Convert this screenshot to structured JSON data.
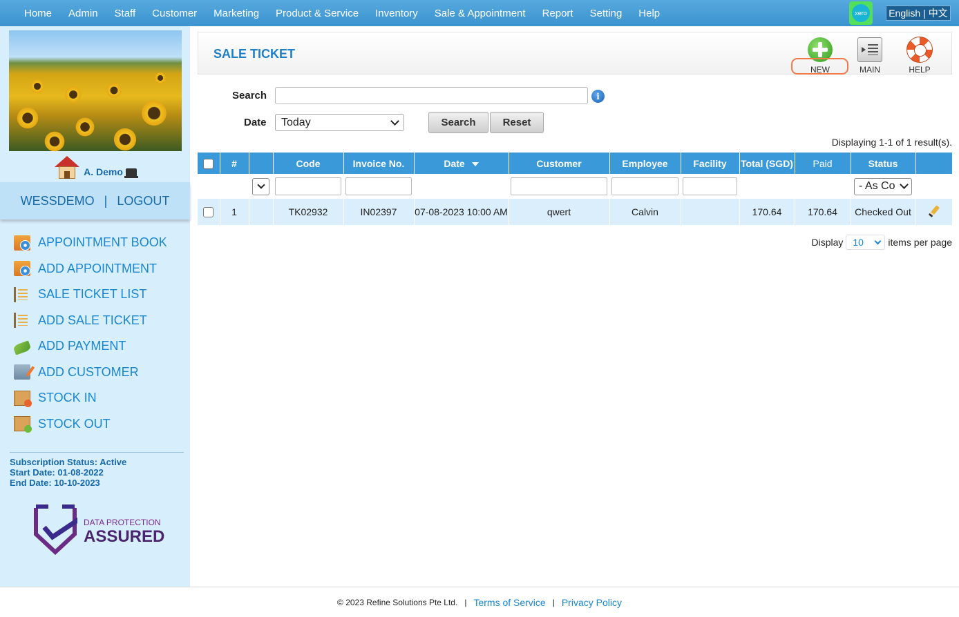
{
  "nav": {
    "items": [
      "Home",
      "Admin",
      "Staff",
      "Customer",
      "Marketing",
      "Product & Service",
      "Inventory",
      "Sale & Appointment",
      "Report",
      "Setting",
      "Help"
    ],
    "xero_label": "xero",
    "lang_english": "English",
    "lang_sep": "|",
    "lang_chinese": "中文"
  },
  "sidebar": {
    "user_name": "A. Demo",
    "company": "WESSDEMO",
    "sep": "|",
    "logout": "LOGOUT",
    "links": [
      {
        "label": "APPOINTMENT BOOK",
        "icon": "calendar-icon"
      },
      {
        "label": "ADD APPOINTMENT",
        "icon": "calendar-add-icon"
      },
      {
        "label": "SALE TICKET LIST",
        "icon": "ticket-list-icon"
      },
      {
        "label": "ADD SALE TICKET",
        "icon": "ticket-add-icon"
      },
      {
        "label": "ADD PAYMENT",
        "icon": "money-icon"
      },
      {
        "label": "ADD CUSTOMER",
        "icon": "customer-card-icon"
      },
      {
        "label": "STOCK IN",
        "icon": "box-in-icon"
      },
      {
        "label": "STOCK OUT",
        "icon": "box-out-icon"
      }
    ],
    "subscription_status": "Subscription Status: Active",
    "start_date": "Start Date: 01-08-2022",
    "end_date": "End Date: 10-10-2023",
    "dpa_line1": "DATA PROTECTION",
    "dpa_line2": "ASSURED"
  },
  "header": {
    "title": "SALE TICKET",
    "new_label": "NEW",
    "main_label": "MAIN",
    "help_label": "HELP"
  },
  "search": {
    "label": "Search",
    "value": "",
    "date_label": "Date",
    "date_value": "Today",
    "search_button": "Search",
    "reset_button": "Reset"
  },
  "results": "Displaying 1-1 of 1 result(s).",
  "table": {
    "columns": [
      "#",
      "Code",
      "Invoice No.",
      "Date",
      "Customer",
      "Employee",
      "Facility",
      "Total (SGD)",
      "Paid",
      "Status"
    ],
    "status_filter": "- As Co",
    "rows": [
      {
        "num": "1",
        "code": "TK02932",
        "invoice": "IN02397",
        "date": "07-08-2023 10:00 AM",
        "customer": "qwert",
        "employee": "Calvin",
        "facility": "",
        "total": "170.64",
        "paid": "170.64",
        "status": "Checked Out"
      }
    ]
  },
  "pager": {
    "display": "Display",
    "per_page_value": "10",
    "items_per_page": "items per page"
  },
  "footer": {
    "copyright": "© 2023 Refine Solutions Pte Ltd.",
    "sep": "|",
    "terms": "Terms of Service",
    "privacy": "Privacy Policy"
  }
}
